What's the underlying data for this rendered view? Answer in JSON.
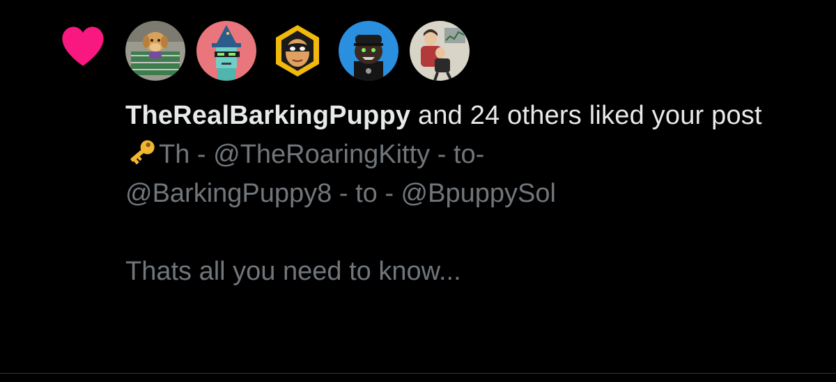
{
  "notification": {
    "type_icon": "heart-icon",
    "accent_color": "#f91880",
    "avatars": [
      {
        "icon": "avatar-dog-shopping-cart"
      },
      {
        "icon": "avatar-wizard-punk"
      },
      {
        "icon": "avatar-masked-face-badge"
      },
      {
        "icon": "avatar-bear-cap"
      },
      {
        "icon": "avatar-illustrated-figures"
      }
    ],
    "actor_name": "TheRealBarkingPuppy",
    "action_text": " and 24 others liked your post",
    "post_preview": {
      "key_icon": "key-icon",
      "line1_prefix": "Th - ",
      "mention1": "@TheRoaringKitty",
      "sep1": " - to-",
      "mention2": "@BarkingPuppy8",
      "sep2": " - to - ",
      "mention3": "@BpuppySol",
      "closing": "Thats all you need to know..."
    }
  }
}
